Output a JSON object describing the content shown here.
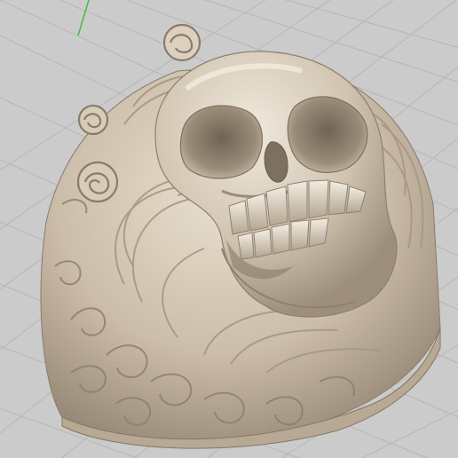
{
  "viewport": {
    "background": "#cbcbcb",
    "grid_minor_color": "#b9b9b9",
    "grid_major_color": "#a9a9a9",
    "y_axis_color": "#3fbf3f",
    "model_base_color": "#cfc1ad",
    "model_shadow_color": "#8a7c6a",
    "model_highlight_color": "#efe6d8"
  },
  "model": {
    "name": "skull-ring-3d-model"
  }
}
